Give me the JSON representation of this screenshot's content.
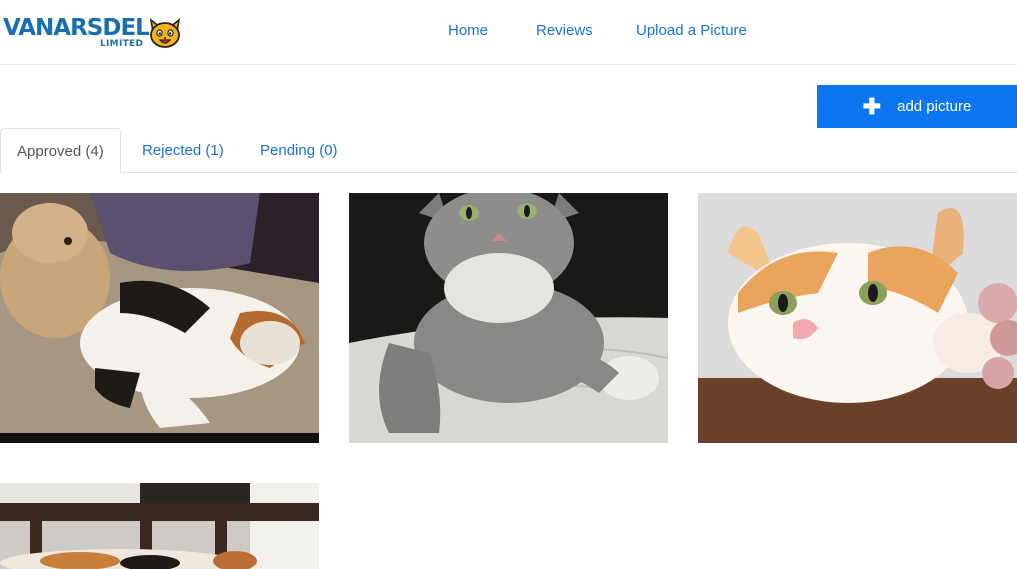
{
  "header": {
    "logo": {
      "main": "VANARSDEL",
      "sub": "LIMITED"
    },
    "nav": [
      {
        "label": "Home"
      },
      {
        "label": "Reviews"
      },
      {
        "label": "Upload a Picture"
      }
    ]
  },
  "actions": {
    "add_picture": "add picture"
  },
  "tabs": [
    {
      "label": "Approved (4)",
      "active": true
    },
    {
      "label": "Rejected (1)",
      "active": false
    },
    {
      "label": "Pending (0)",
      "active": false
    }
  ],
  "gallery": {
    "photos": [
      {
        "subject": "calico cat lying with teddy bear"
      },
      {
        "subject": "grey tabby cat on white quilt"
      },
      {
        "subject": "orange and white cat resting head"
      },
      {
        "subject": "calico cat lying on floor"
      }
    ]
  },
  "colors": {
    "accent": "#0b76f0",
    "link": "#1a73d0",
    "logo": "#1b6fae"
  }
}
